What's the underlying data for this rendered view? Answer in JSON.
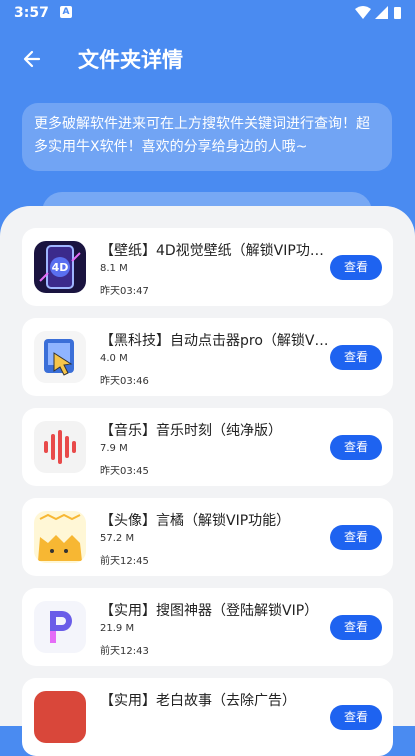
{
  "status_bar": {
    "time": "3:57",
    "notification_icon": "A"
  },
  "header": {
    "title": "文件夹详情",
    "back_icon": "arrow-left-icon"
  },
  "notice": {
    "text": "更多破解软件进来可在上方搜软件关键词进行查询！超多实用牛X软件！喜欢的分享给身边的人哦~"
  },
  "colors": {
    "header_bg": "#4a8bf1",
    "button": "#1e63f0",
    "sheet_bg": "#f2f3f5"
  },
  "items": [
    {
      "name": "【壁纸】4D视觉壁纸（解锁VIP功能）",
      "size": "8.1 M",
      "date": "昨天03:47",
      "action": "查看",
      "icon": "4d-wallpaper-icon"
    },
    {
      "name": "【黑科技】自动点击器pro（解锁VIP）",
      "size": "4.0 M",
      "date": "昨天03:46",
      "action": "查看",
      "icon": "auto-clicker-icon"
    },
    {
      "name": "【音乐】音乐时刻（纯净版）",
      "size": "7.9 M",
      "date": "昨天03:45",
      "action": "查看",
      "icon": "sound-wave-icon"
    },
    {
      "name": "【头像】言橘（解锁VIP功能）",
      "size": "57.2 M",
      "date": "前天12:45",
      "action": "查看",
      "icon": "cat-avatar-icon"
    },
    {
      "name": "【实用】搜图神器（登陆解锁VIP）",
      "size": "21.9 M",
      "date": "前天12:43",
      "action": "查看",
      "icon": "p-letter-icon"
    },
    {
      "name": "【实用】老白故事（去除广告）",
      "size": "",
      "date": "",
      "action": "查看",
      "icon": "story-icon"
    }
  ]
}
